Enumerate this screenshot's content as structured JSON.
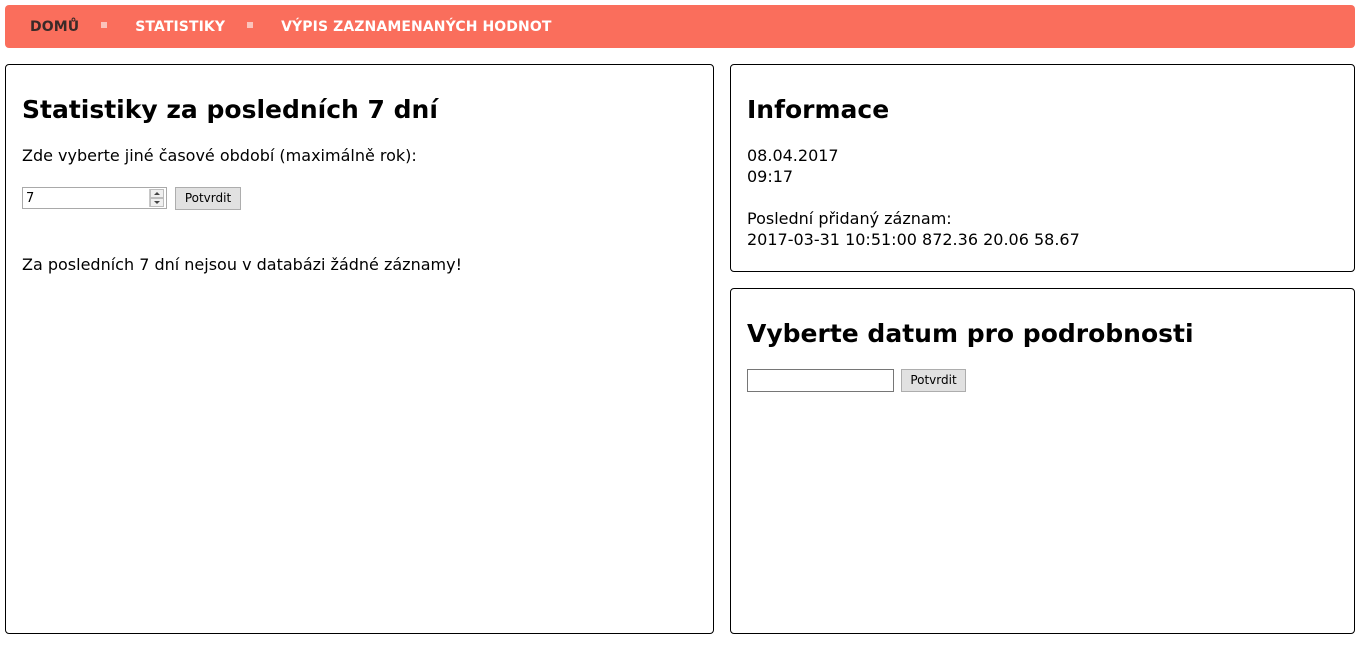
{
  "nav": {
    "items": [
      {
        "label": "DOMŮ",
        "active": true
      },
      {
        "label": "STATISTIKY",
        "active": false
      },
      {
        "label": "VÝPIS ZAZNAMENANÝCH HODNOT",
        "active": false
      }
    ]
  },
  "stats": {
    "title": "Statistiky za posledních 7 dní",
    "prompt": "Zde vyberte jiné časové období (maximálně rok):",
    "days_value": "7",
    "submit_label": "Potvrdit",
    "message": "Za posledních 7 dní nejsou v databázi žádné záznamy!"
  },
  "info": {
    "title": "Informace",
    "date": "08.04.2017",
    "time": "09:17",
    "last_record_label": "Poslední přidaný záznam:",
    "last_record_value": "2017-03-31 10:51:00 872.36 20.06 58.67"
  },
  "date_picker": {
    "title": "Vyberte datum pro podrobnosti",
    "input_value": "",
    "submit_label": "Potvrdit"
  },
  "colors": {
    "nav_background": "#fa6e5c",
    "nav_text": "#ffffff",
    "nav_active_text": "#3a2a28"
  }
}
